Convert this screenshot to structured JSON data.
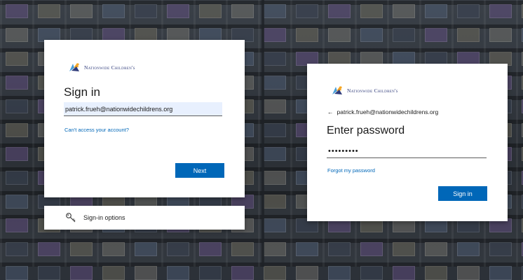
{
  "brand": {
    "name": "Nationwide Children's",
    "colors": {
      "primary": "#0067b8",
      "logo_blue": "#2f3b7a",
      "logo_orange": "#f5a623",
      "logo_light_blue": "#4a9fd8"
    }
  },
  "signin_card": {
    "logo_text": "Nationwide Children's",
    "title": "Sign in",
    "email_value": "patrick.frueh@nationwidechildrens.org",
    "access_link": "Can't access your account?",
    "next_label": "Next"
  },
  "options_bar": {
    "icon": "key-icon",
    "label": "Sign-in options"
  },
  "password_card": {
    "logo_text": "Nationwide Children's",
    "back_icon": "back-arrow-icon",
    "identity": "patrick.frueh@nationwidechildrens.org",
    "title": "Enter password",
    "password_value": "•••••••••",
    "forgot_link": "Forgot my password",
    "signin_label": "Sign in"
  }
}
